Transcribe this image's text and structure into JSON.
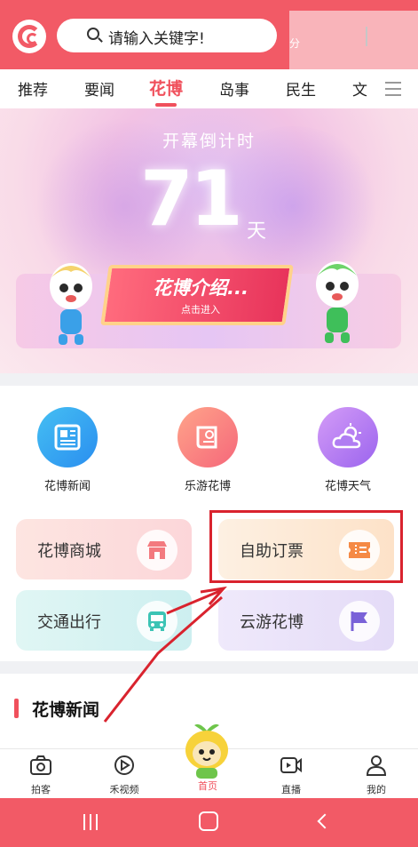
{
  "header": {
    "search_placeholder": "请输入关键字!",
    "share_label": "分"
  },
  "tabs": [
    {
      "label": "推荐",
      "active": false
    },
    {
      "label": "要闻",
      "active": false
    },
    {
      "label": "花博",
      "active": true
    },
    {
      "label": "岛事",
      "active": false
    },
    {
      "label": "民生",
      "active": false
    },
    {
      "label": "文",
      "active": false
    }
  ],
  "banner": {
    "countdown_title": "开幕倒计时",
    "countdown_days": "71",
    "countdown_unit": "天",
    "intro_title": "花博介绍...",
    "intro_subtitle": "点击进入"
  },
  "services": {
    "circles": [
      {
        "label": "花博新闻",
        "icon": "newspaper-icon"
      },
      {
        "label": "乐游花博",
        "icon": "map-scroll-icon"
      },
      {
        "label": "花博天气",
        "icon": "weather-cloud-sun-icon"
      }
    ],
    "cards": [
      {
        "label": "花博商城",
        "icon": "shop-icon"
      },
      {
        "label": "自助订票",
        "icon": "ticket-icon"
      },
      {
        "label": "交通出行",
        "icon": "bus-icon"
      },
      {
        "label": "云游花博",
        "icon": "flag-icon"
      }
    ]
  },
  "news_section": {
    "title": "花博新闻"
  },
  "bottom_nav": [
    {
      "label": "拍客",
      "icon": "camera-icon",
      "active": false
    },
    {
      "label": "禾视频",
      "icon": "play-icon",
      "active": false
    },
    {
      "label": "首页",
      "icon": "mascot-icon",
      "active": true
    },
    {
      "label": "直播",
      "icon": "live-video-icon",
      "active": false
    },
    {
      "label": "我的",
      "icon": "user-icon",
      "active": false
    }
  ],
  "colors": {
    "brand": "#f25a66",
    "accent": "#f0505c",
    "highlight_box": "#d9232e"
  }
}
